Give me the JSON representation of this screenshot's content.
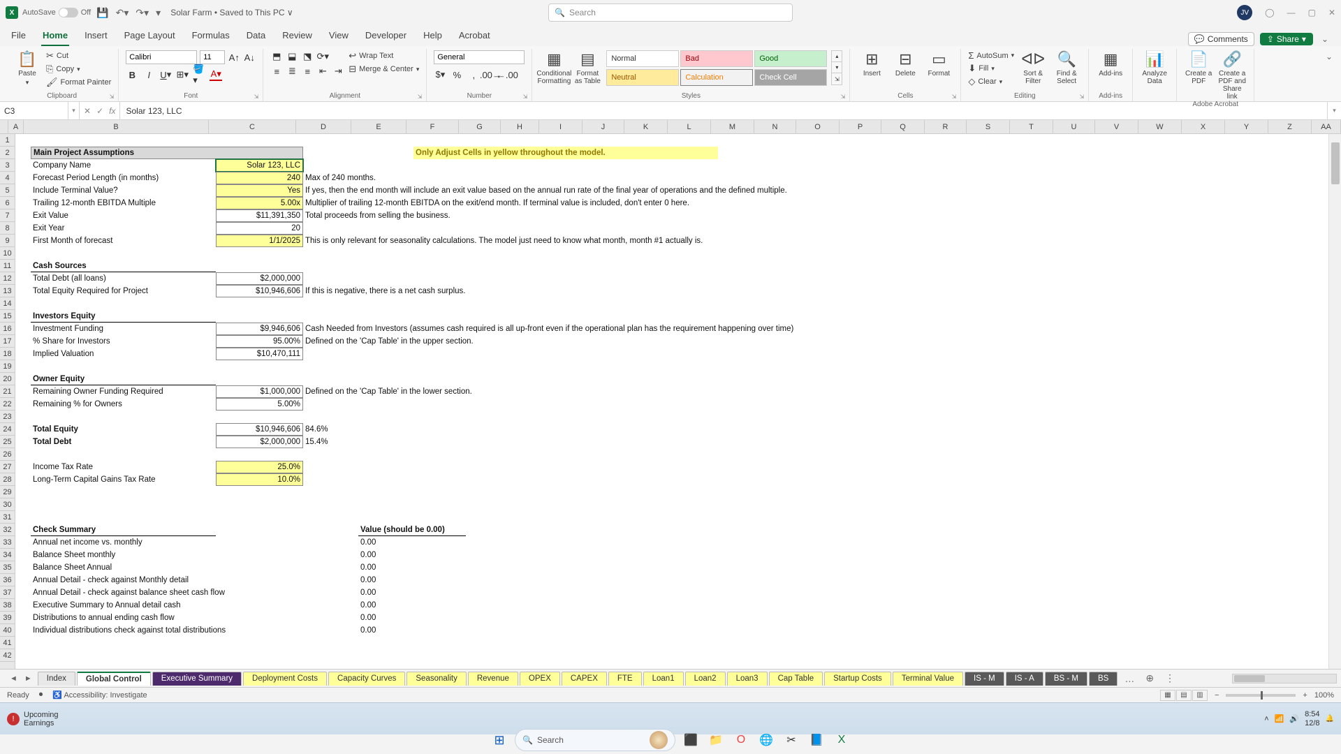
{
  "titlebar": {
    "autosave_label": "AutoSave",
    "autosave_state": "Off",
    "docname": "Solar Farm • Saved to This PC ∨",
    "search_placeholder": "Search",
    "avatar_initials": "JV"
  },
  "tabs": {
    "items": [
      "File",
      "Home",
      "Insert",
      "Page Layout",
      "Formulas",
      "Data",
      "Review",
      "View",
      "Developer",
      "Help",
      "Acrobat"
    ],
    "active": "Home",
    "comments": "Comments",
    "share": "Share"
  },
  "ribbon": {
    "clipboard": {
      "paste": "Paste",
      "cut": "Cut",
      "copy": "Copy",
      "format_painter": "Format Painter",
      "label": "Clipboard"
    },
    "font": {
      "name": "Calibri",
      "size": "11",
      "label": "Font"
    },
    "alignment": {
      "wrap": "Wrap Text",
      "merge": "Merge & Center",
      "label": "Alignment"
    },
    "number": {
      "format": "General",
      "label": "Number"
    },
    "styles": {
      "cond": "Conditional Formatting",
      "fmt_table": "Format as Table",
      "gallery": [
        "Normal",
        "Bad",
        "Good",
        "Neutral",
        "Calculation",
        "Check Cell"
      ],
      "label": "Styles"
    },
    "cells": {
      "insert": "Insert",
      "delete": "Delete",
      "format": "Format",
      "label": "Cells"
    },
    "editing": {
      "autosum": "AutoSum",
      "fill": "Fill",
      "clear": "Clear",
      "sort": "Sort & Filter",
      "find": "Find & Select",
      "label": "Editing"
    },
    "addins": {
      "addins": "Add-ins",
      "label": "Add-ins"
    },
    "analysis": {
      "analyze": "Analyze Data"
    },
    "acrobat": {
      "create": "Create a PDF",
      "share": "Create a PDF and Share link",
      "label": "Adobe Acrobat"
    }
  },
  "formula_bar": {
    "cell_ref": "C3",
    "formula": "Solar 123, LLC"
  },
  "columns": {
    "letters": [
      "A",
      "B",
      "C",
      "D",
      "E",
      "F",
      "G",
      "H",
      "I",
      "J",
      "K",
      "L",
      "M",
      "N",
      "O",
      "P",
      "Q",
      "R",
      "S",
      "T",
      "U",
      "V",
      "W",
      "X",
      "Y",
      "Z",
      "AA"
    ],
    "widths": [
      22,
      265,
      125,
      79,
      79,
      75,
      60,
      55,
      62,
      60,
      62,
      62,
      62,
      60,
      62,
      60,
      62,
      60,
      62,
      62,
      60,
      62,
      62,
      62,
      62,
      62,
      42
    ]
  },
  "rows": {
    "count": 42
  },
  "cells": {
    "banner": "Only Adjust Cells in yellow throughout the model.",
    "assumptions_hdr": "Main Project Assumptions",
    "company_name_lbl": "Company Name",
    "company_name_val": "Solar 123, LLC",
    "fpl_lbl": "Forecast Period Length (in months)",
    "fpl_val": "240",
    "fpl_note": "Max of 240 months.",
    "itv_lbl": "Include Terminal Value?",
    "itv_val": "Yes",
    "itv_note": "If yes, then the end month will include an exit value based on the annual run rate of the final year of operations and the defined multiple.",
    "t12_lbl": "Trailing 12-month EBITDA Multiple",
    "t12_val": "5.00x",
    "t12_note": "Multiplier of trailing 12-month EBITDA on the exit/end month. If terminal value is included, don't enter 0 here.",
    "exitval_lbl": "Exit Value",
    "exitval_val": "$11,391,350",
    "exitval_note": "Total proceeds from selling the business.",
    "exityr_lbl": "Exit Year",
    "exityr_val": "20",
    "fmf_lbl": "   First Month of forecast",
    "fmf_val": "1/1/2025",
    "fmf_note": "This is only relevant for seasonality calculations. The model just need to know what month, month #1 actually is.",
    "cashsrc_hdr": "Cash Sources",
    "td_lbl": "Total Debt (all loans)",
    "td_val": "$2,000,000",
    "ter_lbl": "Total Equity Required for Project",
    "ter_val": "$10,946,606",
    "ter_note": "If this is negative, there is a net cash surplus.",
    "inveq_hdr": "Investors Equity",
    "if_lbl": "Investment Funding",
    "if_val": "$9,946,606",
    "if_note": "Cash Needed from Investors (assumes cash required is all up-front even if the operational plan has the requirement happening over time)",
    "shi_lbl": "% Share for Investors",
    "shi_val": "95.00%",
    "shi_note": "Defined on the 'Cap Table' in the upper section.",
    "iv_lbl": "Implied Valuation",
    "iv_val": "$10,470,111",
    "owneq_hdr": "Owner Equity",
    "rofr_lbl": "Remaining Owner Funding Required",
    "rofr_val": "$1,000,000",
    "rofr_note": "Defined on the 'Cap Table' in the lower section.",
    "rpo_lbl": "Remaining % for Owners",
    "rpo_val": "5.00%",
    "te_lbl": "Total Equity",
    "te_val": "$10,946,606",
    "te_pct": "84.6%",
    "tdr_lbl": "Total Debt",
    "tdr_val": "$2,000,000",
    "tdr_pct": "15.4%",
    "itr_lbl": "Income Tax Rate",
    "itr_val": "25.0%",
    "ltcg_lbl": "Long-Term Capital Gains Tax Rate",
    "ltcg_val": "10.0%",
    "check_hdr": "Check Summary",
    "check_val_hdr": "Value (should be 0.00)",
    "checks": [
      "Annual net income vs. monthly",
      "Balance Sheet monthly",
      "Balance Sheet Annual",
      "Annual Detail - check against Monthly detail",
      "Annual Detail - check against balance sheet cash flow",
      "Executive Summary to Annual detail cash",
      "Distributions to annual ending cash flow",
      "Individual distributions check against total distributions"
    ],
    "check_zero": "0.00"
  },
  "sheet_tabs": {
    "items": [
      {
        "label": "Index",
        "cls": ""
      },
      {
        "label": "Global Control",
        "cls": "active"
      },
      {
        "label": "Executive Summary",
        "cls": "purple"
      },
      {
        "label": "Deployment Costs",
        "cls": "yellow"
      },
      {
        "label": "Capacity Curves",
        "cls": "yellow"
      },
      {
        "label": "Seasonality",
        "cls": "yellow"
      },
      {
        "label": "Revenue",
        "cls": "yellow"
      },
      {
        "label": "OPEX",
        "cls": "yellow"
      },
      {
        "label": "CAPEX",
        "cls": "yellow"
      },
      {
        "label": "FTE",
        "cls": "yellow"
      },
      {
        "label": "Loan1",
        "cls": "yellow"
      },
      {
        "label": "Loan2",
        "cls": "yellow"
      },
      {
        "label": "Loan3",
        "cls": "yellow"
      },
      {
        "label": "Cap Table",
        "cls": "yellow"
      },
      {
        "label": "Startup Costs",
        "cls": "yellow"
      },
      {
        "label": "Terminal Value",
        "cls": "yellow"
      },
      {
        "label": "IS - M",
        "cls": "dark"
      },
      {
        "label": "IS - A",
        "cls": "dark"
      },
      {
        "label": "BS - M",
        "cls": "dark"
      },
      {
        "label": "BS",
        "cls": "dark"
      }
    ]
  },
  "statusbar": {
    "ready": "Ready",
    "acc": "Accessibility: Investigate",
    "zoom": "100%"
  },
  "taskbar": {
    "upcoming_l1": "Upcoming",
    "upcoming_l2": "Earnings",
    "search": "Search",
    "time": "8:54",
    "date": "12/8"
  }
}
